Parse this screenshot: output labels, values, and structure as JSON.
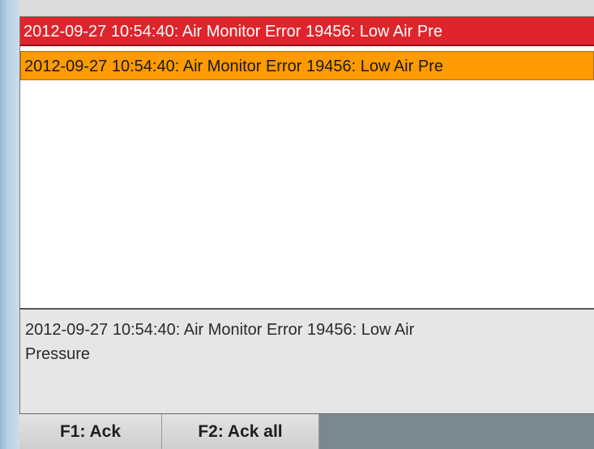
{
  "alarms": {
    "active_row": "2012-09-27 10:54:40: Air Monitor Error 19456: Low Air Pre",
    "unacked_row": "2012-09-27 10:54:40: Air Monitor Error 19456: Low Air Pre"
  },
  "details": {
    "line1": "2012-09-27 10:54:40: Air Monitor Error 19456: Low Air",
    "line2": "Pressure"
  },
  "footer": {
    "ack_label": "F1: Ack",
    "ack_all_label": "F2: Ack all"
  },
  "colors": {
    "active_alarm": "#e0242b",
    "unacked_alarm": "#ff9b00",
    "footer_bar": "#7a8891"
  }
}
